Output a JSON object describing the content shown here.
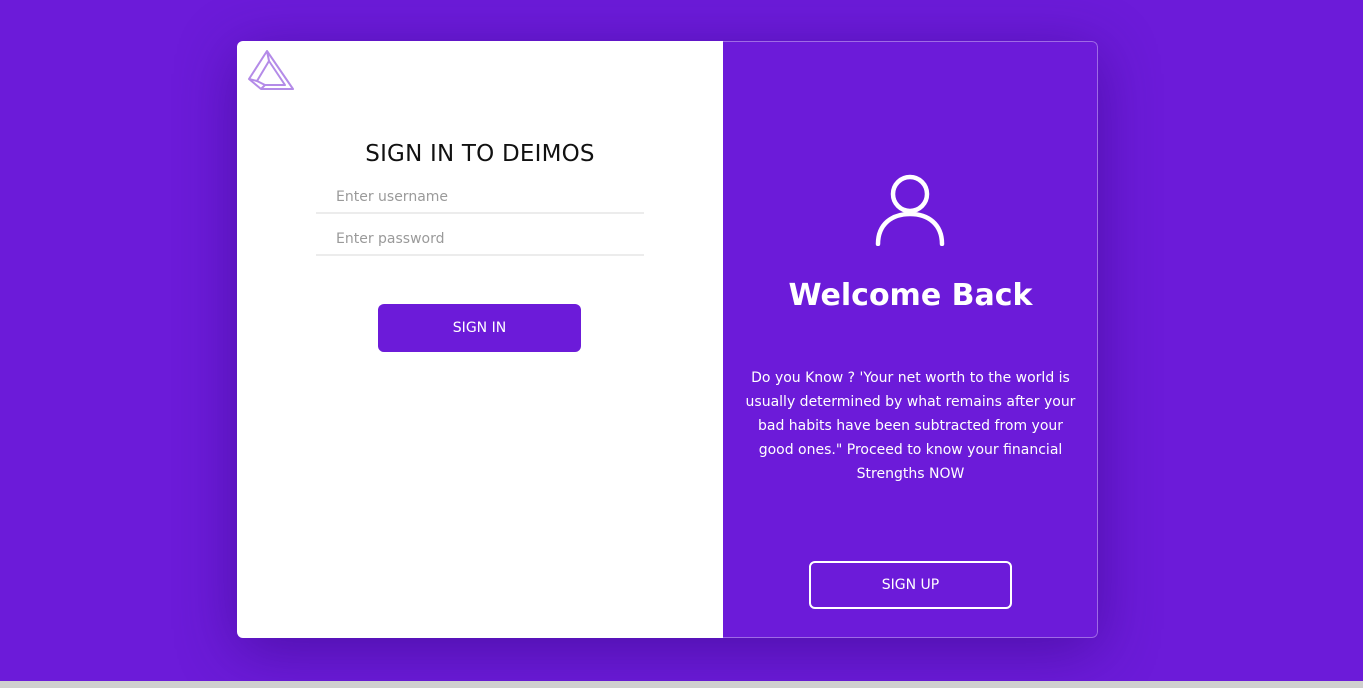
{
  "colors": {
    "accent": "#6c1bd9",
    "panel_left": "#ffffff",
    "logo": "#b48be8"
  },
  "logo": {
    "icon": "deimos-logo-icon"
  },
  "signin": {
    "title": "SIGN IN TO DEIMOS",
    "username_placeholder": "Enter username",
    "password_placeholder": "Enter password",
    "button_label": "SIGN IN"
  },
  "welcome": {
    "icon": "user-icon",
    "heading": "Welcome Back",
    "quote": "Do you Know ? 'Your net worth to the world is usually determined by what remains after your bad habits have been subtracted from your good ones.\" Proceed to know your financial Strengths NOW",
    "signup_label": "SIGN UP"
  }
}
